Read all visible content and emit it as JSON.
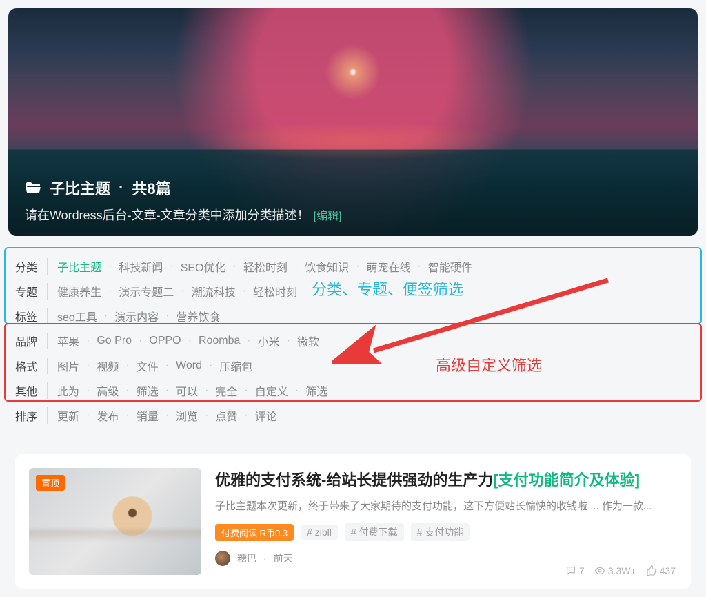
{
  "hero": {
    "category_name": "子比主题",
    "count_text": "共8篇",
    "description": "请在Wordress后台-文章-文章分类中添加分类描述！",
    "edit_label": "[编辑]"
  },
  "filters": {
    "rows": [
      {
        "label": "分类",
        "items": [
          "子比主题",
          "科技新闻",
          "SEO优化",
          "轻松时刻",
          "饮食知识",
          "萌宠在线",
          "智能硬件"
        ],
        "active": 0
      },
      {
        "label": "专题",
        "items": [
          "健康养生",
          "演示专题二",
          "潮流科技",
          "轻松时刻"
        ],
        "active": -1
      },
      {
        "label": "标签",
        "items": [
          "seo工具",
          "演示内容",
          "营养饮食"
        ],
        "active": -1
      },
      {
        "label": "品牌",
        "items": [
          "苹果",
          "Go Pro",
          "OPPO",
          "Roomba",
          "小米",
          "微软"
        ],
        "active": -1
      },
      {
        "label": "格式",
        "items": [
          "图片",
          "视频",
          "文件",
          "Word",
          "压缩包"
        ],
        "active": -1
      },
      {
        "label": "其他",
        "items": [
          "此为",
          "高级",
          "筛选",
          "可以",
          "完全",
          "自定义",
          "筛选"
        ],
        "active": -1
      },
      {
        "label": "排序",
        "items": [
          "更新",
          "发布",
          "销量",
          "浏览",
          "点赞",
          "评论"
        ],
        "active": -1
      }
    ]
  },
  "annotations": {
    "blue_text": "分类、专题、便签筛选",
    "red_text": "高级自定义筛选"
  },
  "post": {
    "sticky_label": "置顶",
    "title_plain": "优雅的支付系统-给站长提供强劲的生产力",
    "title_highlight": "[支付功能简介及体验]",
    "excerpt": "子比主题本次更新，终于带来了大家期待的支付功能，这下方便站长愉快的收钱啦.... 作为一款...",
    "price_badge": "付费阅读 R币0.3",
    "tags": [
      "# zibll",
      "# 付费下载",
      "# 支付功能"
    ],
    "author": "糖巴",
    "date": "前天",
    "comments": "7",
    "views": "3.3W+",
    "likes": "437"
  }
}
